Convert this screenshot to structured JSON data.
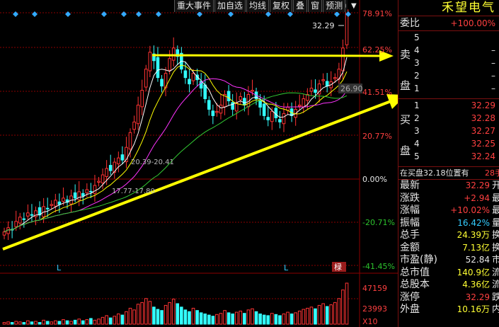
{
  "toolbar": {
    "items": [
      "重大事件",
      "加自选",
      "均线",
      "复权",
      "叠",
      "窗",
      "预测"
    ]
  },
  "price_axis": {
    "labels": [
      {
        "text": "78.91%",
        "color": "#ff4040"
      },
      {
        "text": "62.25%",
        "color": "#ff4040"
      },
      {
        "text": "41.51%",
        "color": "#ff4040"
      },
      {
        "text": "20.77%",
        "color": "#ff4040"
      },
      {
        "text": "0.00%",
        "color": "#e6e6e6"
      },
      {
        "text": "-20.71%",
        "color": "#2dc32d"
      },
      {
        "text": "-41.45%",
        "color": "#2dc32d"
      }
    ]
  },
  "volume_axis": {
    "labels": [
      "47159",
      "23993",
      "X10"
    ]
  },
  "annotations": {
    "high_price": "32.29",
    "mid_price": "26.90",
    "range_1": "20.39-20.41",
    "range_2": "17.77-17.80",
    "marker_left": "L",
    "marker_right": "L",
    "badge": "椂"
  },
  "panel": {
    "stock_name": "禾望电气",
    "weibi_label": "委比",
    "weibi_value": "+100.00%",
    "sell_label": [
      "卖",
      "盘"
    ],
    "buy_label": [
      "买",
      "盘"
    ],
    "sell": [
      {
        "n": "5",
        "price": "",
        "vol": ""
      },
      {
        "n": "4",
        "price": "",
        "vol": "–"
      },
      {
        "n": "3",
        "price": "",
        "vol": "–"
      },
      {
        "n": "2",
        "price": "",
        "vol": "–"
      },
      {
        "n": "1",
        "price": "",
        "vol": "–"
      }
    ],
    "buy": [
      {
        "n": "1",
        "price": "32.29"
      },
      {
        "n": "2",
        "price": "32.28"
      },
      {
        "n": "3",
        "price": "32.27"
      },
      {
        "n": "4",
        "price": "32.25"
      },
      {
        "n": "5",
        "price": "32.24"
      }
    ],
    "notice_left": "在买盘32.18位置有",
    "notice_right": "28手",
    "stats": [
      {
        "label": "最新",
        "value": "32.29",
        "color": "#ff4040",
        "extra": "开"
      },
      {
        "label": "涨跌",
        "value": "+2.94",
        "color": "#ff4040",
        "extra": "最"
      },
      {
        "label": "涨幅",
        "value": "+10.02%",
        "color": "#ff4040",
        "extra": "最"
      },
      {
        "label": "振幅",
        "value": "16.42%",
        "color": "#33ccff",
        "extra": "量"
      },
      {
        "label": "总手",
        "value": "24.39万",
        "color": "#ffff33",
        "extra": "换"
      },
      {
        "label": "金额",
        "value": "7.13亿",
        "color": "#ffff33",
        "extra": "换"
      },
      {
        "label": "市盈(静)",
        "value": "52.84",
        "color": "#e6e6e6",
        "extra": "市"
      },
      {
        "label": "总市值",
        "value": "140.9亿",
        "color": "#ffff33",
        "extra": "流"
      },
      {
        "label": "总股本",
        "value": "4.36亿",
        "color": "#ffff33",
        "extra": "流"
      },
      {
        "label": "涨停",
        "value": "32.29",
        "color": "#ff4040",
        "extra": "跌"
      },
      {
        "label": "外盘",
        "value": "10.16万",
        "color": "#ffff33",
        "extra": "内"
      }
    ]
  },
  "colors": {
    "up": "#ff3333",
    "down": "#33ffff",
    "arrow": "#ffff00",
    "ma5": "#ffffff",
    "ma10": "#ffff00",
    "ma20": "#ff33ff",
    "ma60": "#33cc33",
    "grid": "#8b0000"
  },
  "chart_data": {
    "type": "candlestick",
    "close_pct": [
      -25,
      -23,
      -24,
      -20,
      -18,
      -19,
      -16,
      -17,
      -15,
      -17,
      -13,
      -14,
      -12,
      -10,
      -12,
      -9,
      -11,
      -8,
      -9,
      -6,
      -8,
      -5,
      -6,
      -3,
      -1,
      2,
      5,
      4,
      8,
      10,
      9,
      15,
      22,
      27,
      35,
      42,
      52,
      60,
      56,
      48,
      44,
      50,
      57,
      62,
      58,
      52,
      48,
      45,
      50,
      47,
      43,
      38,
      33,
      30,
      32,
      35,
      40,
      37,
      33,
      36,
      39,
      35,
      40,
      42,
      38,
      34,
      30,
      28,
      32,
      29,
      27,
      31,
      34,
      30,
      33,
      35,
      38,
      40,
      43,
      41,
      45,
      47,
      44,
      46,
      48,
      52,
      62,
      80
    ],
    "volume": [
      3,
      4,
      3,
      5,
      4,
      3,
      6,
      4,
      5,
      3,
      7,
      5,
      4,
      6,
      5,
      8,
      6,
      5,
      7,
      9,
      6,
      8,
      10,
      7,
      9,
      12,
      15,
      11,
      14,
      18,
      16,
      22,
      28,
      25,
      35,
      38,
      45,
      40,
      30,
      26,
      24,
      33,
      38,
      44,
      36,
      30,
      25,
      22,
      28,
      24,
      20,
      18,
      16,
      14,
      17,
      19,
      24,
      20,
      18,
      21,
      23,
      19,
      25,
      27,
      22,
      18,
      16,
      15,
      19,
      17,
      15,
      18,
      21,
      18,
      20,
      23,
      26,
      28,
      30,
      27,
      33,
      36,
      31,
      34,
      38,
      45,
      60,
      72
    ]
  }
}
